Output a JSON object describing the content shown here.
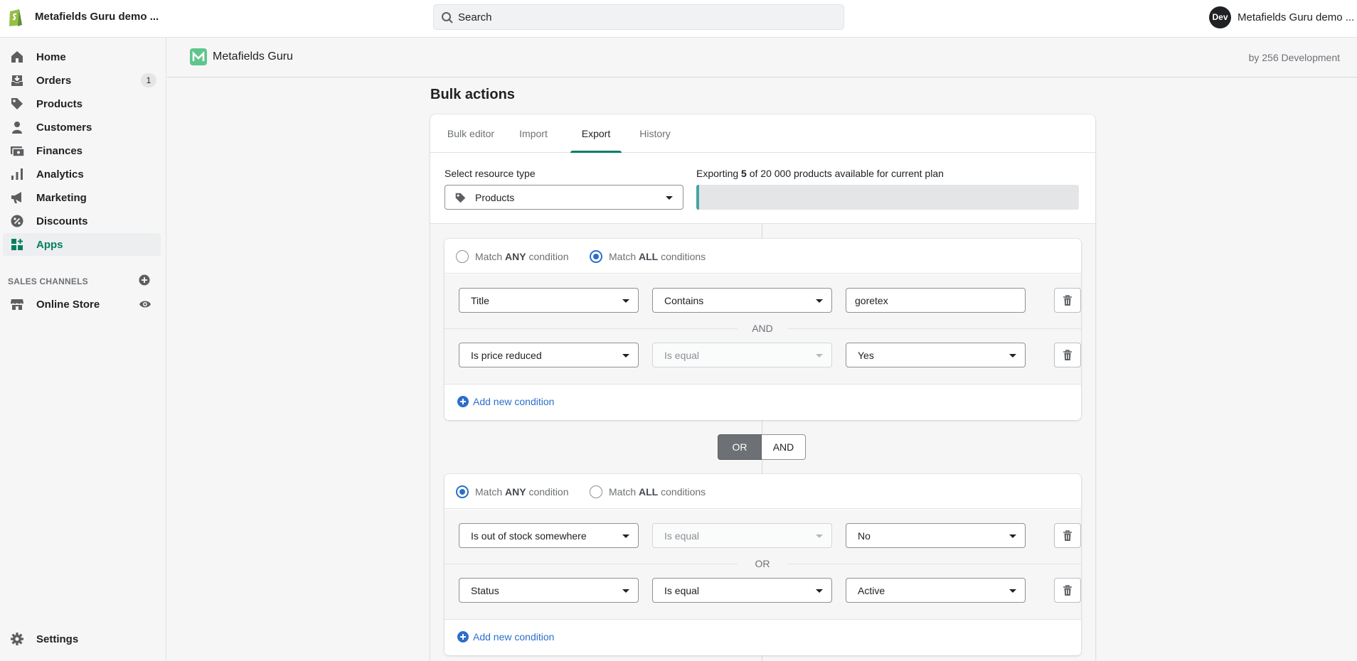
{
  "topbar": {
    "shop_name": "Metafields Guru demo ...",
    "search_placeholder": "Search",
    "avatar_initials": "Dev",
    "user_name": "Metafields Guru demo ..."
  },
  "sidebar": {
    "items": [
      {
        "label": "Home",
        "icon": "home-icon"
      },
      {
        "label": "Orders",
        "icon": "orders-icon",
        "badge": "1"
      },
      {
        "label": "Products",
        "icon": "tag-icon"
      },
      {
        "label": "Customers",
        "icon": "person-icon"
      },
      {
        "label": "Finances",
        "icon": "finances-icon"
      },
      {
        "label": "Analytics",
        "icon": "analytics-icon"
      },
      {
        "label": "Marketing",
        "icon": "megaphone-icon"
      },
      {
        "label": "Discounts",
        "icon": "discount-icon"
      },
      {
        "label": "Apps",
        "icon": "apps-icon",
        "active": true
      }
    ],
    "sales_channels_label": "SALES CHANNELS",
    "online_store_label": "Online Store",
    "settings_label": "Settings",
    "accent_color": "#007f5f"
  },
  "app_header": {
    "title": "Metafields Guru",
    "by": "by 256 Development"
  },
  "page": {
    "title": "Bulk actions",
    "tabs": [
      "Bulk editor",
      "Import",
      "Export",
      "History"
    ],
    "active_tab": "Export"
  },
  "export": {
    "resource_label": "Select resource type",
    "resource_value": "Products",
    "quota_prefix": "Exporting ",
    "quota_count": "5",
    "quota_suffix": " of 20 000 products available for current plan",
    "progress_fraction": 0.00025
  },
  "groups": [
    {
      "match_any_label_pre": "Match ",
      "match_any_bold": "ANY",
      "match_any_label_post": " condition",
      "match_all_label_pre": "Match ",
      "match_all_bold": "ALL",
      "match_all_label_post": " conditions",
      "selected": "all",
      "joiner": "AND",
      "conditions": [
        {
          "field": "Title",
          "operator": "Contains",
          "value": "goretex",
          "value_type": "text"
        },
        {
          "field": "Is price reduced",
          "operator": "Is equal",
          "operator_disabled": true,
          "value": "Yes",
          "value_type": "select"
        }
      ],
      "add_label": "Add new condition"
    },
    {
      "match_any_label_pre": "Match ",
      "match_any_bold": "ANY",
      "match_any_label_post": " condition",
      "match_all_label_pre": "Match ",
      "match_all_bold": "ALL",
      "match_all_label_post": " conditions",
      "selected": "any",
      "joiner": "OR",
      "conditions": [
        {
          "field": "Is out of stock somewhere",
          "operator": "Is equal",
          "operator_disabled": true,
          "value": "No",
          "value_type": "select"
        },
        {
          "field": "Status",
          "operator": "Is equal",
          "value": "Active",
          "value_type": "select"
        }
      ],
      "add_label": "Add new condition"
    }
  ],
  "group_joiner": {
    "or_label": "OR",
    "and_label": "AND",
    "selected": "OR"
  }
}
